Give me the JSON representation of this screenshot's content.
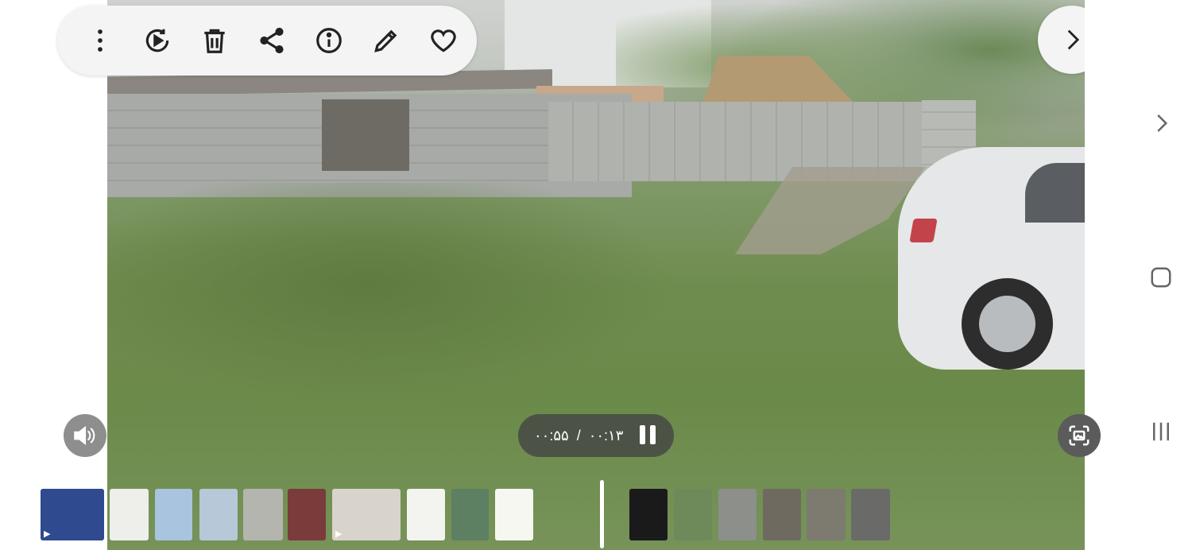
{
  "toolbar": {
    "buttons": [
      {
        "name": "more-options-button",
        "icon": "more-vertical-icon"
      },
      {
        "name": "auto-play-button",
        "icon": "play-circle-icon"
      },
      {
        "name": "delete-button",
        "icon": "trash-icon"
      },
      {
        "name": "share-button",
        "icon": "share-icon"
      },
      {
        "name": "details-button",
        "icon": "info-icon"
      },
      {
        "name": "edit-button",
        "icon": "pencil-icon"
      },
      {
        "name": "favorite-button",
        "icon": "heart-icon"
      }
    ]
  },
  "player": {
    "current_time": "۰۰:۱۳",
    "separator": "/",
    "duration": "۰۰:۵۵",
    "state": "playing"
  },
  "colors": {
    "pill_bg": "#f4f4f4",
    "player_bg": "#464646",
    "icon": "#222222"
  },
  "thumbnails": [
    {
      "kind": "video",
      "color": "#2f4a8f"
    },
    {
      "kind": "image",
      "color": "#eeeeea"
    },
    {
      "kind": "image",
      "color": "#a9c4de"
    },
    {
      "kind": "image",
      "color": "#b7c8d8"
    },
    {
      "kind": "image",
      "color": "#b5b5b0"
    },
    {
      "kind": "image",
      "color": "#7a3b3b"
    },
    {
      "kind": "video",
      "color": "#d8d4cc"
    },
    {
      "kind": "image",
      "color": "#f3f3f0"
    },
    {
      "kind": "image",
      "color": "#5d7f62"
    },
    {
      "kind": "image",
      "color": "#f7f7f2"
    },
    {
      "kind": "image",
      "color": "#1a1a1a"
    },
    {
      "kind": "image",
      "color": "#6f8a5a"
    },
    {
      "kind": "image",
      "color": "#8c8f8a"
    },
    {
      "kind": "image",
      "color": "#6e6a5f"
    },
    {
      "kind": "image",
      "color": "#7d7a70"
    },
    {
      "kind": "image",
      "color": "#6a6a68"
    }
  ]
}
